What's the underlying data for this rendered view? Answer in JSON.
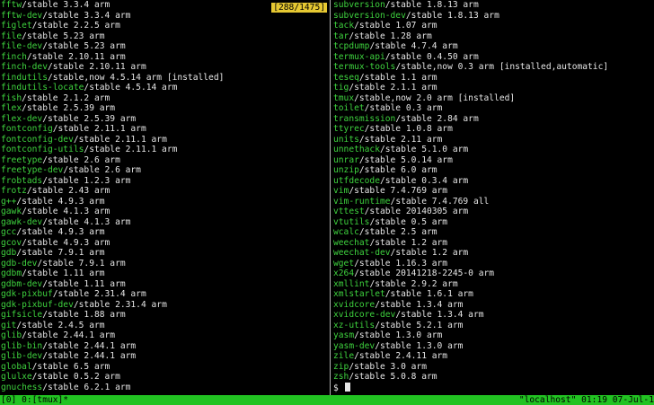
{
  "left_pane": {
    "counter": "[288/1475]",
    "lines": [
      {
        "pkg": "fftw",
        "rest": "/stable 3.3.4 arm"
      },
      {
        "pkg": "fftw-dev",
        "rest": "/stable 3.3.4 arm"
      },
      {
        "pkg": "figlet",
        "rest": "/stable 2.2.5 arm"
      },
      {
        "pkg": "file",
        "rest": "/stable 5.23 arm"
      },
      {
        "pkg": "file-dev",
        "rest": "/stable 5.23 arm"
      },
      {
        "pkg": "finch",
        "rest": "/stable 2.10.11 arm"
      },
      {
        "pkg": "finch-dev",
        "rest": "/stable 2.10.11 arm"
      },
      {
        "pkg": "findutils",
        "rest": "/stable,now 4.5.14 arm [installed]"
      },
      {
        "pkg": "findutils-locate",
        "rest": "/stable 4.5.14 arm"
      },
      {
        "pkg": "fish",
        "rest": "/stable 2.1.2 arm"
      },
      {
        "pkg": "flex",
        "rest": "/stable 2.5.39 arm"
      },
      {
        "pkg": "flex-dev",
        "rest": "/stable 2.5.39 arm"
      },
      {
        "pkg": "fontconfig",
        "rest": "/stable 2.11.1 arm"
      },
      {
        "pkg": "fontconfig-dev",
        "rest": "/stable 2.11.1 arm"
      },
      {
        "pkg": "fontconfig-utils",
        "rest": "/stable 2.11.1 arm"
      },
      {
        "pkg": "freetype",
        "rest": "/stable 2.6 arm"
      },
      {
        "pkg": "freetype-dev",
        "rest": "/stable 2.6 arm"
      },
      {
        "pkg": "frobtads",
        "rest": "/stable 1.2.3 arm"
      },
      {
        "pkg": "frotz",
        "rest": "/stable 2.43 arm"
      },
      {
        "pkg": "g++",
        "rest": "/stable 4.9.3 arm"
      },
      {
        "pkg": "gawk",
        "rest": "/stable 4.1.3 arm"
      },
      {
        "pkg": "gawk-dev",
        "rest": "/stable 4.1.3 arm"
      },
      {
        "pkg": "gcc",
        "rest": "/stable 4.9.3 arm"
      },
      {
        "pkg": "gcov",
        "rest": "/stable 4.9.3 arm"
      },
      {
        "pkg": "gdb",
        "rest": "/stable 7.9.1 arm"
      },
      {
        "pkg": "gdb-dev",
        "rest": "/stable 7.9.1 arm"
      },
      {
        "pkg": "gdbm",
        "rest": "/stable 1.11 arm"
      },
      {
        "pkg": "gdbm-dev",
        "rest": "/stable 1.11 arm"
      },
      {
        "pkg": "gdk-pixbuf",
        "rest": "/stable 2.31.4 arm"
      },
      {
        "pkg": "gdk-pixbuf-dev",
        "rest": "/stable 2.31.4 arm"
      },
      {
        "pkg": "gifsicle",
        "rest": "/stable 1.88 arm"
      },
      {
        "pkg": "git",
        "rest": "/stable 2.4.5 arm"
      },
      {
        "pkg": "glib",
        "rest": "/stable 2.44.1 arm"
      },
      {
        "pkg": "glib-bin",
        "rest": "/stable 2.44.1 arm"
      },
      {
        "pkg": "glib-dev",
        "rest": "/stable 2.44.1 arm"
      },
      {
        "pkg": "global",
        "rest": "/stable 6.5 arm"
      },
      {
        "pkg": "glulxe",
        "rest": "/stable 0.5.2 arm"
      },
      {
        "pkg": "gnuchess",
        "rest": "/stable 6.2.1 arm"
      }
    ]
  },
  "right_pane": {
    "lines": [
      {
        "pkg": "subversion",
        "rest": "/stable 1.8.13 arm"
      },
      {
        "pkg": "subversion-dev",
        "rest": "/stable 1.8.13 arm"
      },
      {
        "pkg": "tack",
        "rest": "/stable 1.07 arm"
      },
      {
        "pkg": "tar",
        "rest": "/stable 1.28 arm"
      },
      {
        "pkg": "tcpdump",
        "rest": "/stable 4.7.4 arm"
      },
      {
        "pkg": "termux-api",
        "rest": "/stable 0.4.50 arm"
      },
      {
        "pkg": "termux-tools",
        "rest": "/stable,now 0.3 arm [installed,automatic]"
      },
      {
        "pkg": "teseq",
        "rest": "/stable 1.1 arm"
      },
      {
        "pkg": "tig",
        "rest": "/stable 2.1.1 arm"
      },
      {
        "pkg": "tmux",
        "rest": "/stable,now 2.0 arm [installed]"
      },
      {
        "pkg": "toilet",
        "rest": "/stable 0.3 arm"
      },
      {
        "pkg": "transmission",
        "rest": "/stable 2.84 arm"
      },
      {
        "pkg": "ttyrec",
        "rest": "/stable 1.0.8 arm"
      },
      {
        "pkg": "units",
        "rest": "/stable 2.11 arm"
      },
      {
        "pkg": "unnethack",
        "rest": "/stable 5.1.0 arm"
      },
      {
        "pkg": "unrar",
        "rest": "/stable 5.0.14 arm"
      },
      {
        "pkg": "unzip",
        "rest": "/stable 6.0 arm"
      },
      {
        "pkg": "utfdecode",
        "rest": "/stable 0.3.4 arm"
      },
      {
        "pkg": "vim",
        "rest": "/stable 7.4.769 arm"
      },
      {
        "pkg": "vim-runtime",
        "rest": "/stable 7.4.769 all"
      },
      {
        "pkg": "vttest",
        "rest": "/stable 20140305 arm"
      },
      {
        "pkg": "vtutils",
        "rest": "/stable 0.5 arm"
      },
      {
        "pkg": "wcalc",
        "rest": "/stable 2.5 arm"
      },
      {
        "pkg": "weechat",
        "rest": "/stable 1.2 arm"
      },
      {
        "pkg": "weechat-dev",
        "rest": "/stable 1.2 arm"
      },
      {
        "pkg": "wget",
        "rest": "/stable 1.16.3 arm"
      },
      {
        "pkg": "x264",
        "rest": "/stable 20141218-2245-0 arm"
      },
      {
        "pkg": "xmllint",
        "rest": "/stable 2.9.2 arm"
      },
      {
        "pkg": "xmlstarlet",
        "rest": "/stable 1.6.1 arm"
      },
      {
        "pkg": "xvidcore",
        "rest": "/stable 1.3.4 arm"
      },
      {
        "pkg": "xvidcore-dev",
        "rest": "/stable 1.3.4 arm"
      },
      {
        "pkg": "xz-utils",
        "rest": "/stable 5.2.1 arm"
      },
      {
        "pkg": "yasm",
        "rest": "/stable 1.3.0 arm"
      },
      {
        "pkg": "yasm-dev",
        "rest": "/stable 1.3.0 arm"
      },
      {
        "pkg": "zile",
        "rest": "/stable 2.4.11 arm"
      },
      {
        "pkg": "zip",
        "rest": "/stable 3.0 arm"
      },
      {
        "pkg": "zsh",
        "rest": "/stable 5.0.8 arm"
      }
    ],
    "prompt": "$"
  },
  "status_bar": {
    "left": "[0] 0:[tmux]*",
    "right": "\"localhost\" 01:19 07-Jul-1"
  },
  "colors": {
    "background": "#000000",
    "package_name": "#3ed23e",
    "text": "#e6e6e6",
    "status_bar": "#22c322",
    "counter_badge": "#e6c832"
  }
}
